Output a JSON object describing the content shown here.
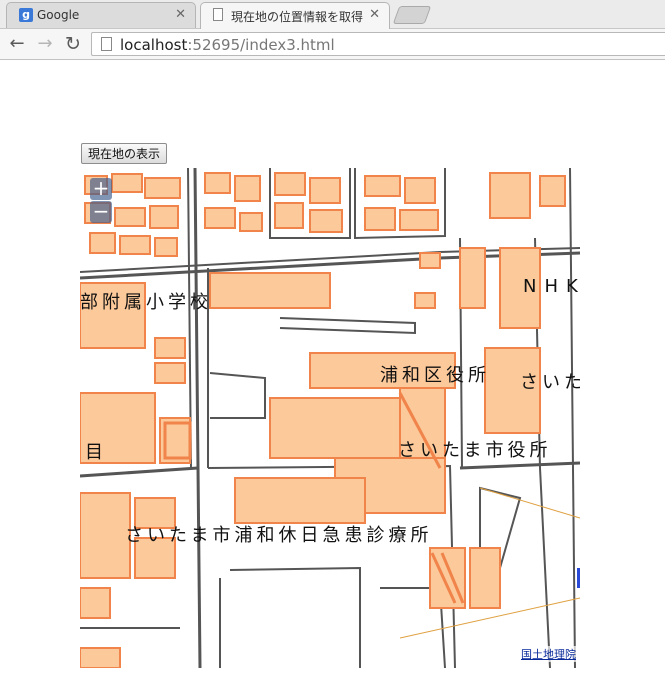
{
  "tabs": [
    {
      "title": "Google",
      "favicon": "google-icon"
    },
    {
      "title": "現在地の位置情報を取得",
      "favicon": "page-icon"
    }
  ],
  "toolbar": {
    "url_host": "localhost",
    "url_rest": ":52695/index3.html"
  },
  "page": {
    "button_label": "現在地の表示"
  },
  "map": {
    "zoom_in": "+",
    "zoom_out": "−",
    "attribution": "国土地理院",
    "labels": [
      "部附属小学校",
      "NHK",
      "浦和区役所",
      "さいた",
      "目",
      "さいたま市役所",
      "さいたま市浦和休日急患診療所"
    ],
    "colors": {
      "building_fill": "#fcc99a",
      "building_outline": "#f0844a",
      "road": "#555555"
    }
  }
}
